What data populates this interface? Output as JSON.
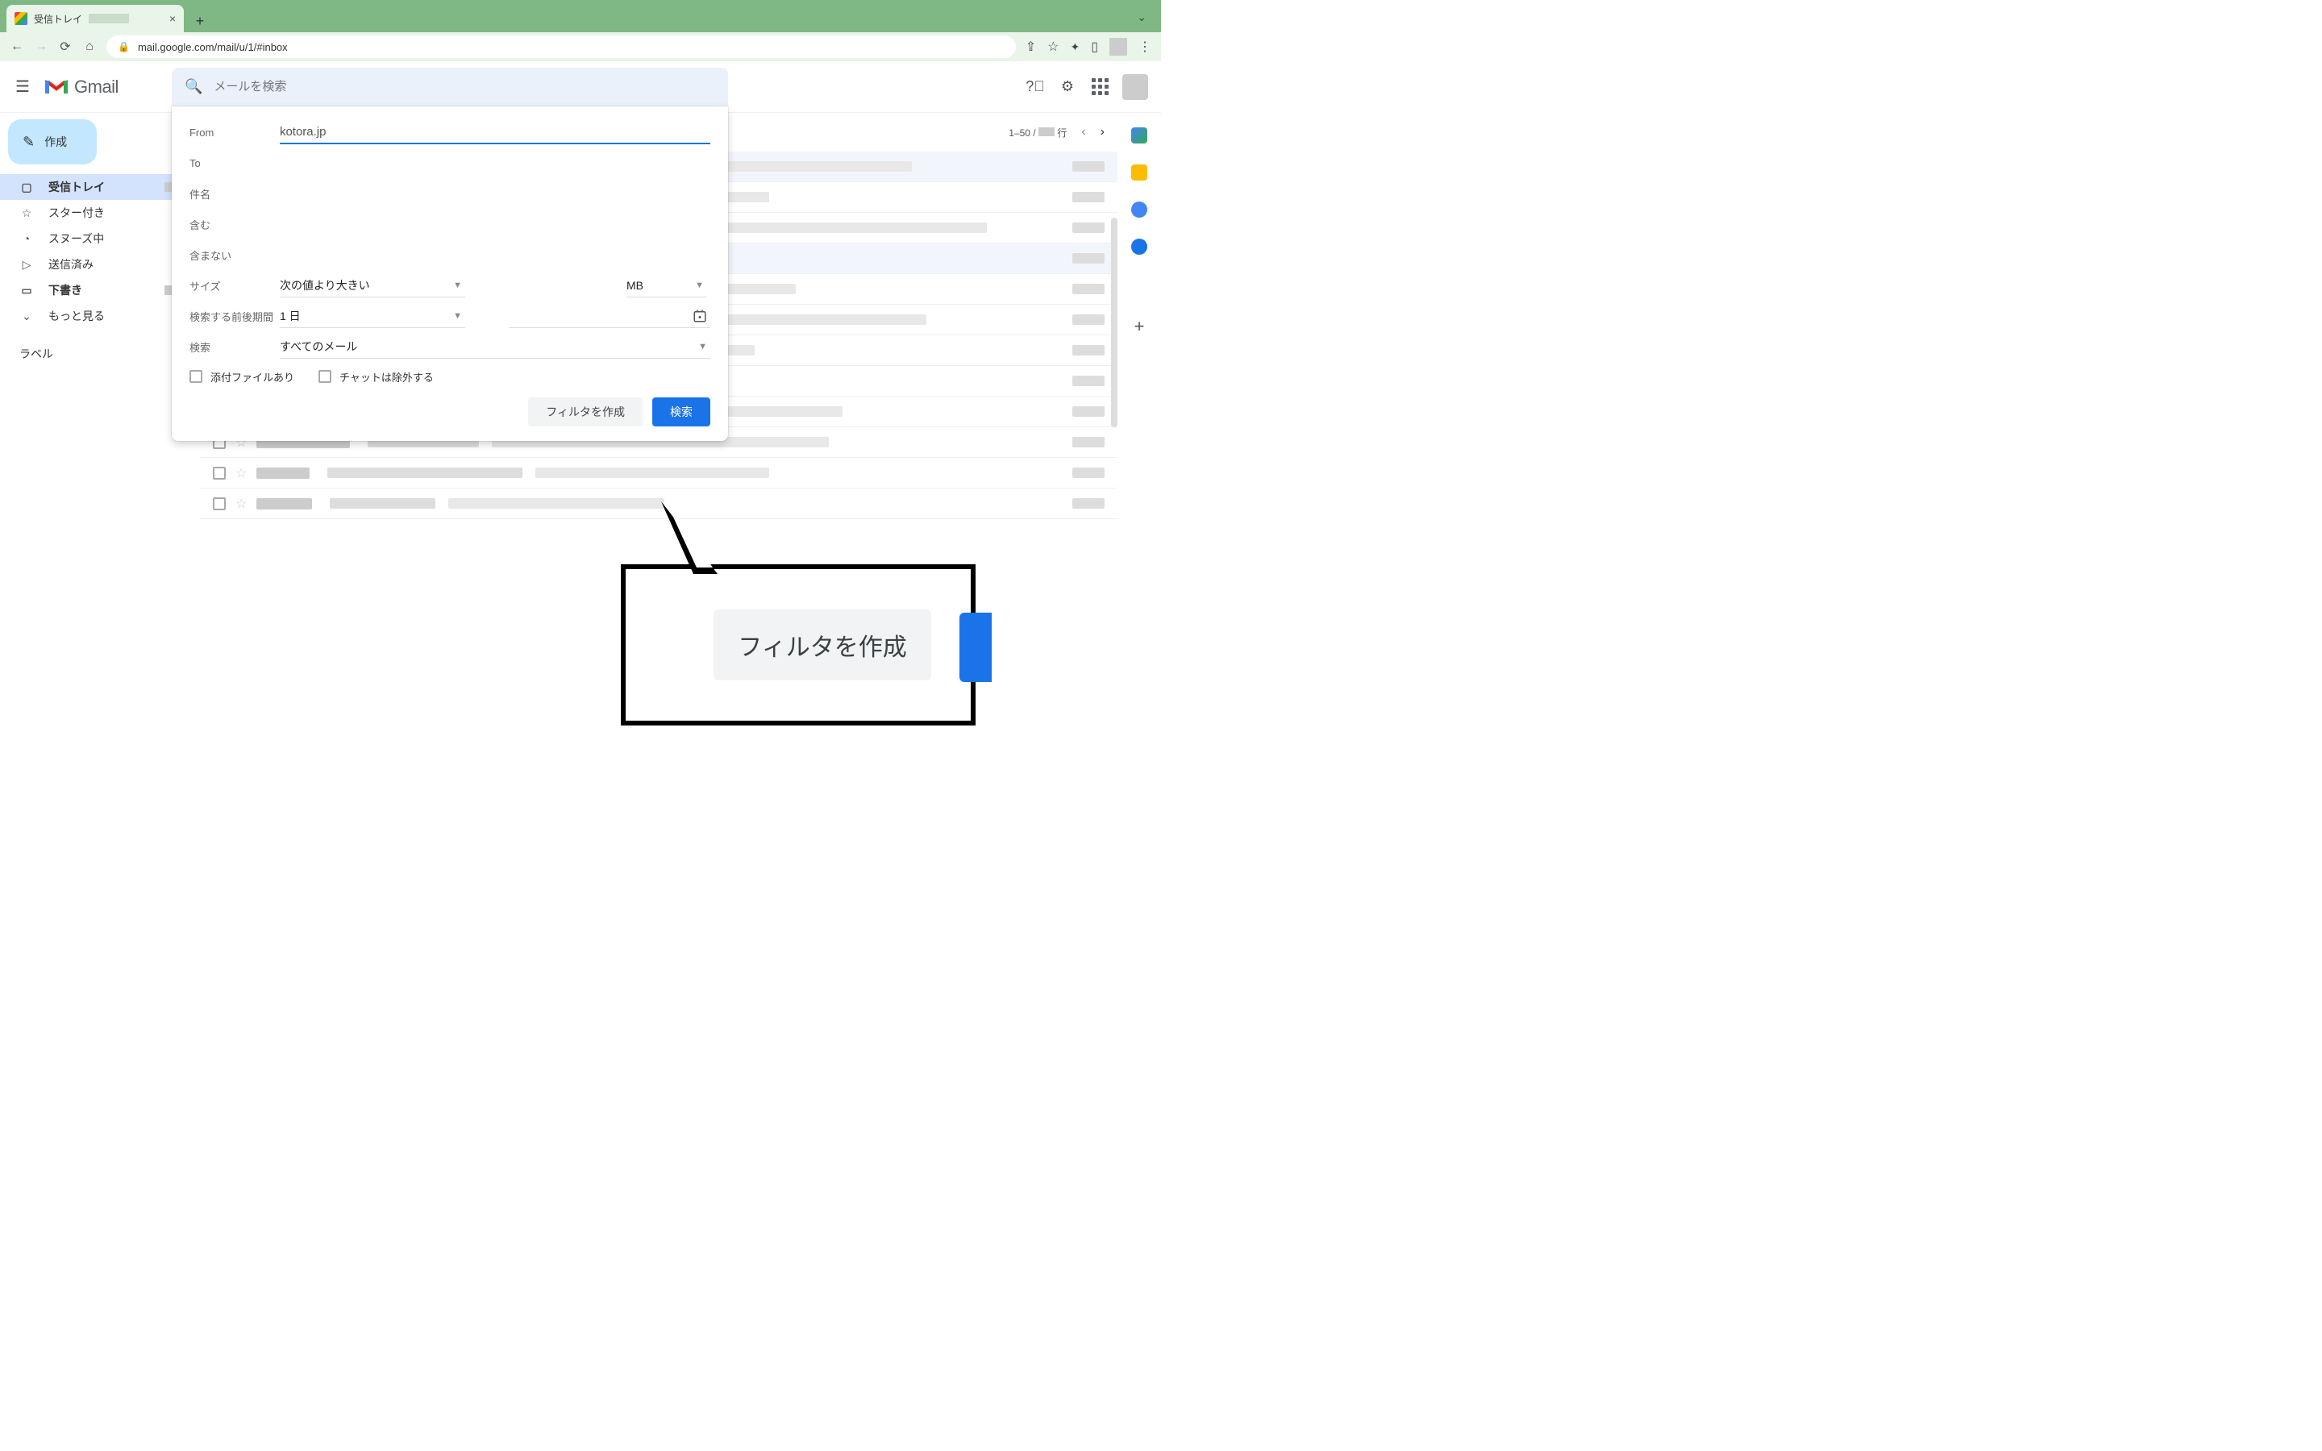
{
  "browser": {
    "tab_title": "受信トレイ",
    "url": "mail.google.com/mail/u/1/#inbox"
  },
  "gmail": {
    "product": "Gmail",
    "search_placeholder": "メールを検索"
  },
  "sidebar": {
    "compose": "作成",
    "items": [
      {
        "icon": "▢",
        "label": "受信トレイ",
        "active": true,
        "has_count": true
      },
      {
        "icon": "☆",
        "label": "スター付き"
      },
      {
        "icon": "◔",
        "label": "スヌーズ中"
      },
      {
        "icon": "▷",
        "label": "送信済み"
      },
      {
        "icon": "▭",
        "label": "下書き",
        "bold": true,
        "has_count": true
      },
      {
        "icon": "⌄",
        "label": "もっと見る"
      }
    ],
    "labels_heading": "ラベル"
  },
  "toolbar": {
    "range": "1–50 /",
    "unit": "行"
  },
  "adv_search": {
    "from_label": "From",
    "from_value": "kotora.jp",
    "to_label": "To",
    "subject_label": "件名",
    "has_words_label": "含む",
    "not_words_label": "含まない",
    "size_label": "サイズ",
    "size_op": "次の値より大きい",
    "size_unit": "MB",
    "date_label": "検索する前後期間",
    "date_range": "1 日",
    "search_in_label": "検索",
    "search_in_value": "すべてのメール",
    "chk_attach": "添付ファイルあり",
    "chk_chat": "チャットは除外する",
    "btn_filter": "フィルタを作成",
    "btn_search": "検索"
  },
  "callout": {
    "text": "フィルタを作成"
  },
  "colors": {
    "accent": "#1a73e8",
    "chrome_green": "#80b885",
    "compose_bg": "#c2e7ff",
    "active_bg": "#d3e3fd"
  }
}
